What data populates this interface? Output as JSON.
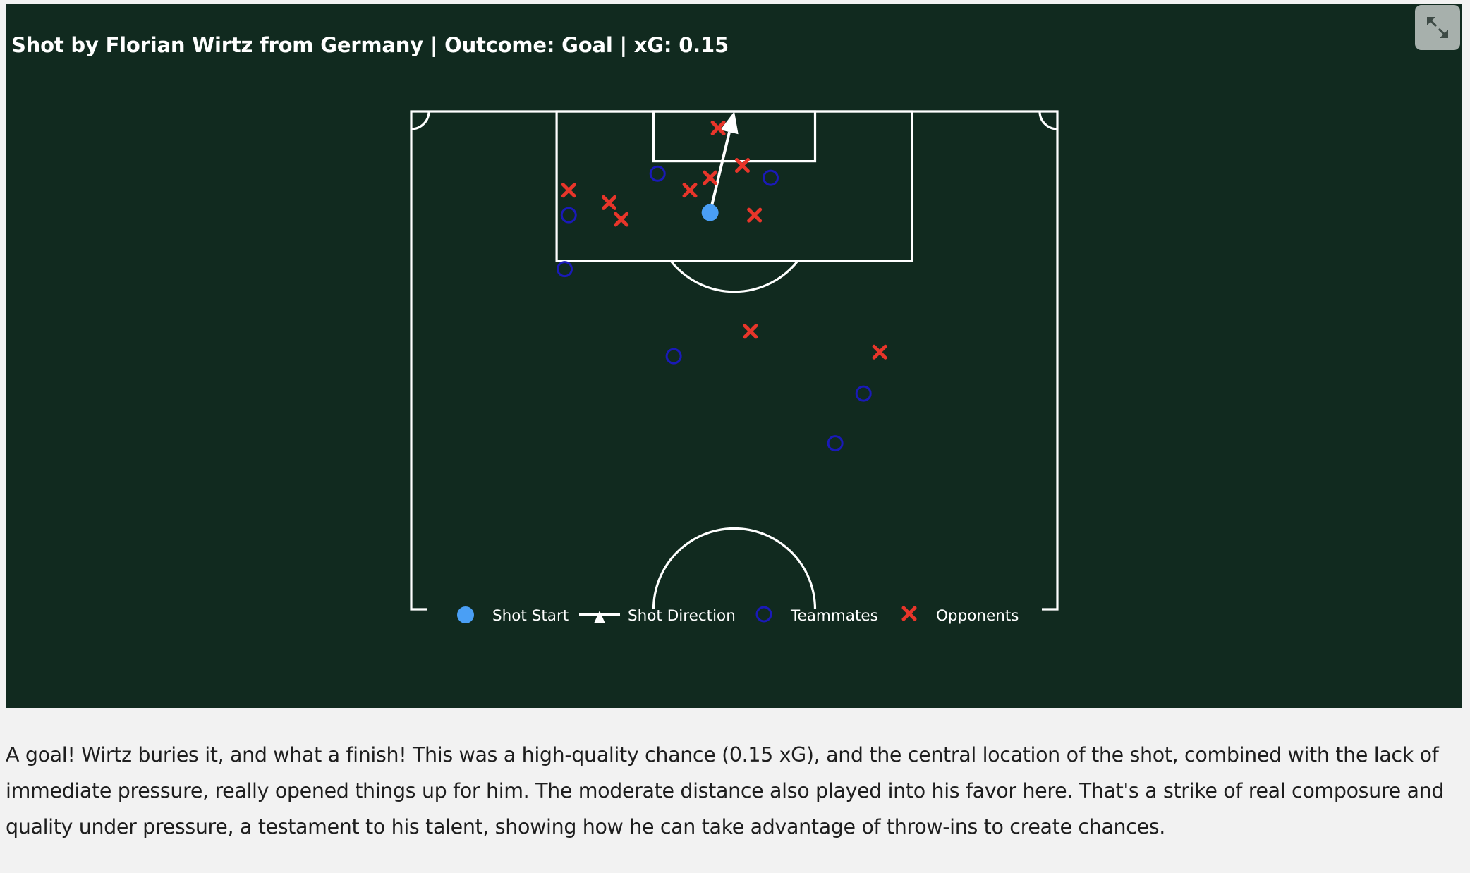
{
  "header": {
    "title": "Shot by Florian Wirtz from Germany | Outcome: Goal | xG: 0.15"
  },
  "toolbar": {
    "expand_icon": "expand-arrows-icon"
  },
  "colors": {
    "background": "#112a1f",
    "pitch_lines": "#ffffff",
    "shot_start": "#4a9ff5",
    "shot_direction": "#ffffff",
    "teammates": "#1a1ab8",
    "opponents": "#e8352a"
  },
  "chart_data": {
    "type": "scatter",
    "pitch": "half-pitch, vertical, attacking up, 120 x 80 units",
    "shot": {
      "start": {
        "x": 107.8,
        "y": 37.0
      },
      "end": {
        "x": 120.0,
        "y": 40.0
      },
      "outcome": "Goal",
      "xg": 0.15
    },
    "series": [
      {
        "name": "Teammates",
        "marker": "hollow-circle",
        "points": [
          {
            "x": 112.5,
            "y": 30.5
          },
          {
            "x": 112.0,
            "y": 44.5
          },
          {
            "x": 107.5,
            "y": 19.5
          },
          {
            "x": 101.0,
            "y": 19.0
          },
          {
            "x": 90.5,
            "y": 32.5
          },
          {
            "x": 86.0,
            "y": 56.0
          },
          {
            "x": 80.0,
            "y": 52.5
          }
        ]
      },
      {
        "name": "Opponents",
        "marker": "x",
        "points": [
          {
            "x": 118.0,
            "y": 38.0
          },
          {
            "x": 113.5,
            "y": 41.0
          },
          {
            "x": 112.0,
            "y": 37.0
          },
          {
            "x": 110.5,
            "y": 34.5
          },
          {
            "x": 107.5,
            "y": 42.5
          },
          {
            "x": 109.0,
            "y": 24.5
          },
          {
            "x": 110.5,
            "y": 19.5
          },
          {
            "x": 107.0,
            "y": 26.0
          },
          {
            "x": 93.5,
            "y": 42.0
          },
          {
            "x": 91.0,
            "y": 58.0
          }
        ]
      }
    ],
    "legend": {
      "placement": "bottom-center",
      "items": [
        "Shot Start",
        "Shot Direction",
        "Teammates",
        "Opponents"
      ]
    }
  },
  "description": "A goal! Wirtz buries it, and what a finish! This was a high-quality chance (0.15 xG), and the central location of the shot, combined with the lack of immediate pressure, really opened things up for him. The moderate distance also played into his favor here. That's a strike of real composure and quality under pressure, a testament to his talent, showing how he can take advantage of throw-ins to create chances."
}
